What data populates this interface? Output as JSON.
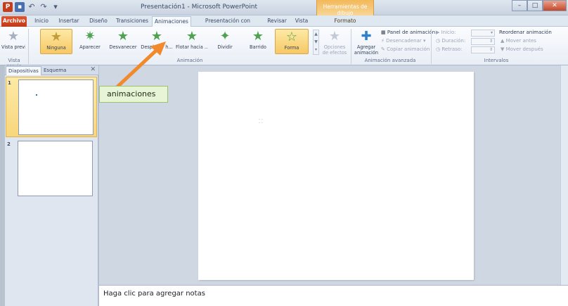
{
  "window": {
    "title": "Presentación1 - Microsoft PowerPoint",
    "tools_title": "Herramientas de dibujo"
  },
  "tabs": [
    {
      "label": "Archivo"
    },
    {
      "label": "Inicio"
    },
    {
      "label": "Insertar"
    },
    {
      "label": "Diseño"
    },
    {
      "label": "Transiciones"
    },
    {
      "label": "Animaciones"
    },
    {
      "label": "Presentación con diapositivas"
    },
    {
      "label": "Revisar"
    },
    {
      "label": "Vista"
    },
    {
      "label": "Formato"
    }
  ],
  "ribbon": {
    "preview": {
      "label": "Vista previa",
      "group": "Vista previa"
    },
    "animations": [
      {
        "label": "Ninguna"
      },
      {
        "label": "Aparecer"
      },
      {
        "label": "Desvanecer"
      },
      {
        "label": "Desplazar h..."
      },
      {
        "label": "Flotar hacia ..."
      },
      {
        "label": "Dividir"
      },
      {
        "label": "Barrido"
      },
      {
        "label": "Forma"
      }
    ],
    "effect_options": "Opciones de efectos",
    "animation_group": "Animación",
    "add_animation": "Agregar animación",
    "advanced": {
      "panel": "Panel de animación",
      "trigger": "Desencadenar",
      "copy": "Copiar animación",
      "group": "Animación avanzada"
    },
    "timing": {
      "start": "Inicio:",
      "duration": "Duración:",
      "delay": "Retraso:",
      "reorder": "Reordenar animación",
      "move_earlier": "Mover antes",
      "move_later": "Mover después",
      "group": "Intervalos"
    }
  },
  "left_pane": {
    "tabs": [
      "Diapositivas",
      "Esquema"
    ],
    "slides": [
      "1",
      "2"
    ]
  },
  "notes": {
    "placeholder": "Haga clic para agregar notas"
  },
  "callout": {
    "text": "animaciones"
  },
  "colors": {
    "accent_orange": "#f08a2c",
    "file_tab": "#c23a18",
    "selection": "#f7c864"
  }
}
